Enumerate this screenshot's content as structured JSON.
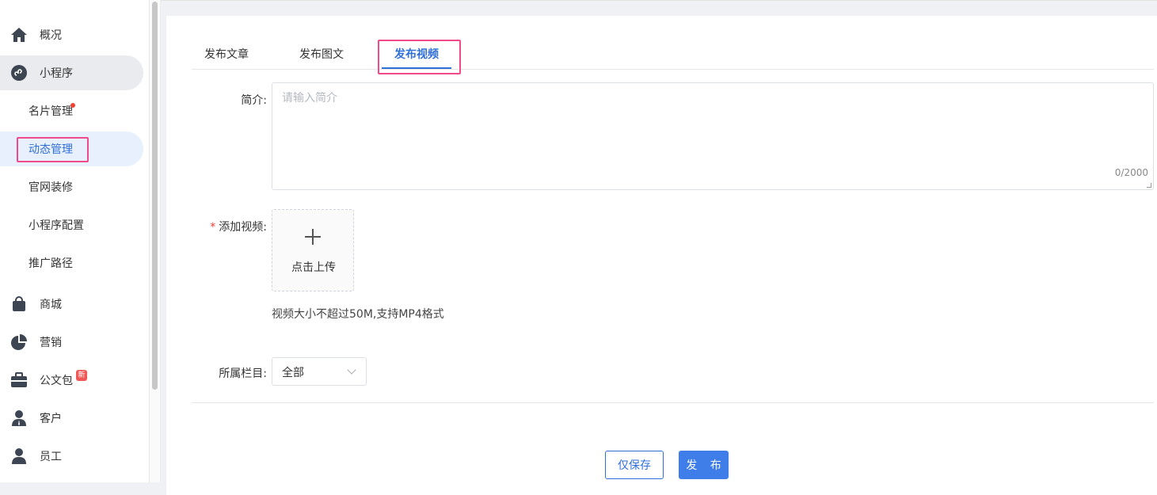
{
  "sidebar": {
    "items": [
      {
        "label": "概况",
        "icon": "home-icon"
      },
      {
        "label": "小程序",
        "icon": "mini-program-icon"
      },
      {
        "label": "商城",
        "icon": "shopping-bag-icon"
      },
      {
        "label": "营销",
        "icon": "pie-chart-icon"
      },
      {
        "label": "公文包",
        "icon": "briefcase-icon",
        "badge": "新"
      },
      {
        "label": "客户",
        "icon": "customer-icon"
      },
      {
        "label": "员工",
        "icon": "employee-icon"
      }
    ],
    "sub_items": [
      {
        "label": "名片管理",
        "has_dot": true
      },
      {
        "label": "动态管理",
        "active": true
      },
      {
        "label": "官网装修"
      },
      {
        "label": "小程序配置"
      },
      {
        "label": "推广路径"
      }
    ]
  },
  "tabs": [
    {
      "label": "发布文章"
    },
    {
      "label": "发布图文"
    },
    {
      "label": "发布视频",
      "active": true
    }
  ],
  "form": {
    "intro_label": "简介",
    "intro_placeholder": "请输入简介",
    "intro_count": "0/2000",
    "video_label": "添加视频",
    "required_mark": "*",
    "upload_text": "点击上传",
    "video_hint": "视频大小不超过50M,支持MP4格式",
    "column_label": "所属栏目",
    "column_value": "全部",
    "colon": ":"
  },
  "actions": {
    "save_only": "仅保存",
    "publish": "发 布"
  },
  "colors": {
    "accent": "#2f6fd8",
    "highlight_box": "#f04a8a",
    "required": "#f04134"
  }
}
